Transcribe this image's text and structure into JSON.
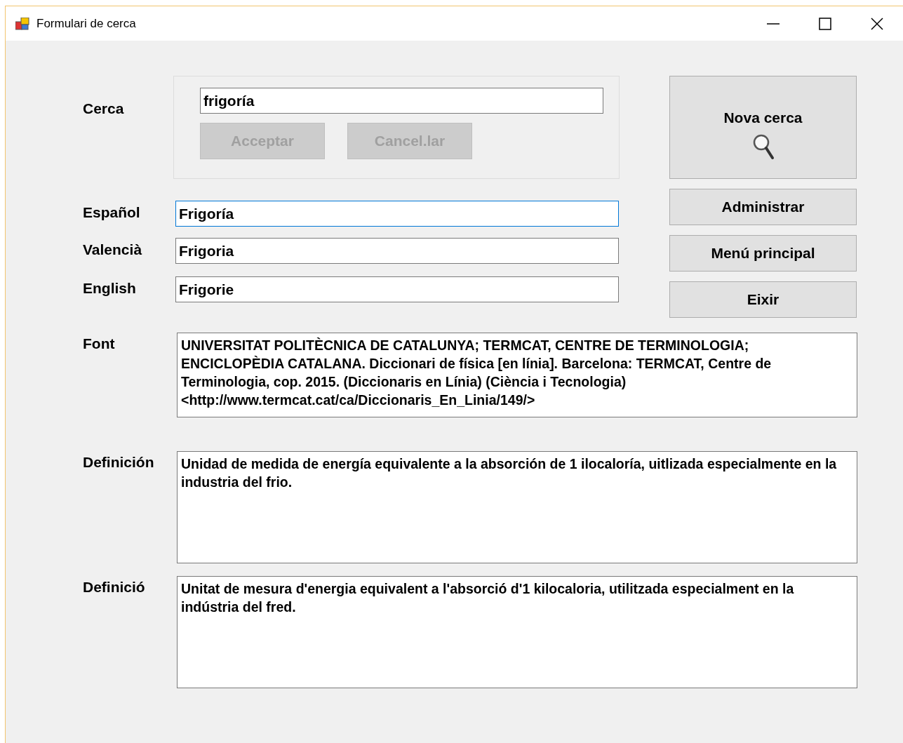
{
  "window": {
    "title": "Formulari de cerca"
  },
  "search": {
    "label": "Cerca",
    "value": "frigoría",
    "buttons": [
      {
        "label": "Acceptar",
        "disabled": true
      },
      {
        "label": "Cancel.lar",
        "disabled": true
      }
    ]
  },
  "terms": [
    {
      "label": "Español",
      "value": "Frigoría",
      "focused": true
    },
    {
      "label": "Valencià",
      "value": "Frigoria",
      "focused": false
    },
    {
      "label": "English",
      "value": "Frigorie",
      "focused": false
    }
  ],
  "actions": [
    {
      "label": "Nova cerca",
      "kind": "search"
    },
    {
      "label": "Administrar",
      "kind": "plain"
    },
    {
      "label": "Menú principal",
      "kind": "plain"
    },
    {
      "label": "Eixir",
      "kind": "plain"
    }
  ],
  "details": [
    {
      "label": "Font",
      "value": "UNIVERSITAT POLITÈCNICA DE CATALUNYA; TERMCAT, CENTRE DE TERMINOLOGIA; ENCICLOPÈDIA CATALANA. Diccionari de física [en línia]. Barcelona: TERMCAT, Centre de Terminologia, cop. 2015. (Diccionaris en Línia) (Ciència i Tecnologia)<http://www.termcat.cat/ca/Diccionaris_En_Linia/149/>"
    },
    {
      "label": "Definición",
      "value": "Unidad de medida de energía equivalente a la absorción de 1 ilocaloría, uitlizada especialmente en la industria del frio."
    },
    {
      "label": "Definició",
      "value": "Unitat de mesura d'energia equivalent a l'absorció d'1 kilocaloria, utilitzada especialment en la indústria del fred."
    }
  ]
}
